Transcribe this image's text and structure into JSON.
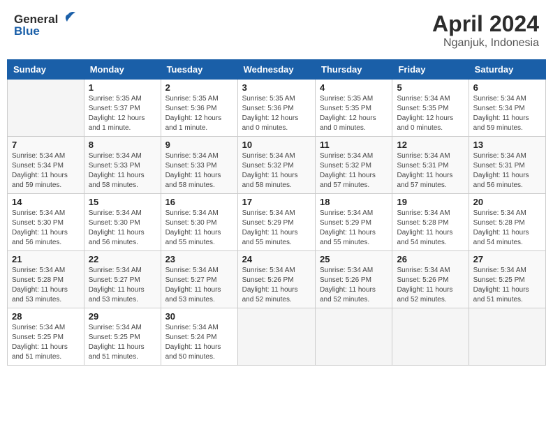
{
  "header": {
    "logo_general": "General",
    "logo_blue": "Blue",
    "title": "April 2024",
    "location": "Nganjuk, Indonesia"
  },
  "weekdays": [
    "Sunday",
    "Monday",
    "Tuesday",
    "Wednesday",
    "Thursday",
    "Friday",
    "Saturday"
  ],
  "weeks": [
    [
      {
        "day": "",
        "info": ""
      },
      {
        "day": "1",
        "info": "Sunrise: 5:35 AM\nSunset: 5:37 PM\nDaylight: 12 hours\nand 1 minute."
      },
      {
        "day": "2",
        "info": "Sunrise: 5:35 AM\nSunset: 5:36 PM\nDaylight: 12 hours\nand 1 minute."
      },
      {
        "day": "3",
        "info": "Sunrise: 5:35 AM\nSunset: 5:36 PM\nDaylight: 12 hours\nand 0 minutes."
      },
      {
        "day": "4",
        "info": "Sunrise: 5:35 AM\nSunset: 5:35 PM\nDaylight: 12 hours\nand 0 minutes."
      },
      {
        "day": "5",
        "info": "Sunrise: 5:34 AM\nSunset: 5:35 PM\nDaylight: 12 hours\nand 0 minutes."
      },
      {
        "day": "6",
        "info": "Sunrise: 5:34 AM\nSunset: 5:34 PM\nDaylight: 11 hours\nand 59 minutes."
      }
    ],
    [
      {
        "day": "7",
        "info": "Sunrise: 5:34 AM\nSunset: 5:34 PM\nDaylight: 11 hours\nand 59 minutes."
      },
      {
        "day": "8",
        "info": "Sunrise: 5:34 AM\nSunset: 5:33 PM\nDaylight: 11 hours\nand 58 minutes."
      },
      {
        "day": "9",
        "info": "Sunrise: 5:34 AM\nSunset: 5:33 PM\nDaylight: 11 hours\nand 58 minutes."
      },
      {
        "day": "10",
        "info": "Sunrise: 5:34 AM\nSunset: 5:32 PM\nDaylight: 11 hours\nand 58 minutes."
      },
      {
        "day": "11",
        "info": "Sunrise: 5:34 AM\nSunset: 5:32 PM\nDaylight: 11 hours\nand 57 minutes."
      },
      {
        "day": "12",
        "info": "Sunrise: 5:34 AM\nSunset: 5:31 PM\nDaylight: 11 hours\nand 57 minutes."
      },
      {
        "day": "13",
        "info": "Sunrise: 5:34 AM\nSunset: 5:31 PM\nDaylight: 11 hours\nand 56 minutes."
      }
    ],
    [
      {
        "day": "14",
        "info": "Sunrise: 5:34 AM\nSunset: 5:30 PM\nDaylight: 11 hours\nand 56 minutes."
      },
      {
        "day": "15",
        "info": "Sunrise: 5:34 AM\nSunset: 5:30 PM\nDaylight: 11 hours\nand 56 minutes."
      },
      {
        "day": "16",
        "info": "Sunrise: 5:34 AM\nSunset: 5:30 PM\nDaylight: 11 hours\nand 55 minutes."
      },
      {
        "day": "17",
        "info": "Sunrise: 5:34 AM\nSunset: 5:29 PM\nDaylight: 11 hours\nand 55 minutes."
      },
      {
        "day": "18",
        "info": "Sunrise: 5:34 AM\nSunset: 5:29 PM\nDaylight: 11 hours\nand 55 minutes."
      },
      {
        "day": "19",
        "info": "Sunrise: 5:34 AM\nSunset: 5:28 PM\nDaylight: 11 hours\nand 54 minutes."
      },
      {
        "day": "20",
        "info": "Sunrise: 5:34 AM\nSunset: 5:28 PM\nDaylight: 11 hours\nand 54 minutes."
      }
    ],
    [
      {
        "day": "21",
        "info": "Sunrise: 5:34 AM\nSunset: 5:28 PM\nDaylight: 11 hours\nand 53 minutes."
      },
      {
        "day": "22",
        "info": "Sunrise: 5:34 AM\nSunset: 5:27 PM\nDaylight: 11 hours\nand 53 minutes."
      },
      {
        "day": "23",
        "info": "Sunrise: 5:34 AM\nSunset: 5:27 PM\nDaylight: 11 hours\nand 53 minutes."
      },
      {
        "day": "24",
        "info": "Sunrise: 5:34 AM\nSunset: 5:26 PM\nDaylight: 11 hours\nand 52 minutes."
      },
      {
        "day": "25",
        "info": "Sunrise: 5:34 AM\nSunset: 5:26 PM\nDaylight: 11 hours\nand 52 minutes."
      },
      {
        "day": "26",
        "info": "Sunrise: 5:34 AM\nSunset: 5:26 PM\nDaylight: 11 hours\nand 52 minutes."
      },
      {
        "day": "27",
        "info": "Sunrise: 5:34 AM\nSunset: 5:25 PM\nDaylight: 11 hours\nand 51 minutes."
      }
    ],
    [
      {
        "day": "28",
        "info": "Sunrise: 5:34 AM\nSunset: 5:25 PM\nDaylight: 11 hours\nand 51 minutes."
      },
      {
        "day": "29",
        "info": "Sunrise: 5:34 AM\nSunset: 5:25 PM\nDaylight: 11 hours\nand 51 minutes."
      },
      {
        "day": "30",
        "info": "Sunrise: 5:34 AM\nSunset: 5:24 PM\nDaylight: 11 hours\nand 50 minutes."
      },
      {
        "day": "",
        "info": ""
      },
      {
        "day": "",
        "info": ""
      },
      {
        "day": "",
        "info": ""
      },
      {
        "day": "",
        "info": ""
      }
    ]
  ]
}
